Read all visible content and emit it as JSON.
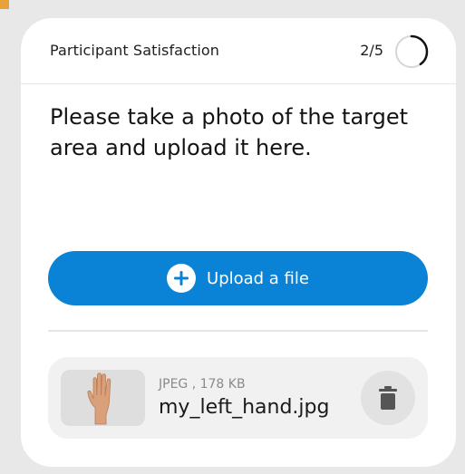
{
  "header": {
    "title": "Participant Satisfaction",
    "progress_label": "2/5",
    "progress_fraction": 0.4
  },
  "question": {
    "text": "Please take a photo of the target area and upload it here."
  },
  "upload": {
    "label": "Upload a file",
    "icon": "plus-circle-icon"
  },
  "file": {
    "meta": "JPEG , 178 KB",
    "name": "my_left_hand.jpg",
    "thumbnail_icon": "hand-photo",
    "delete_icon": "trash-icon"
  },
  "colors": {
    "accent": "#0a82d6",
    "background": "#e8e8e8",
    "card": "#ffffff",
    "file_row": "#f1f1f1"
  }
}
